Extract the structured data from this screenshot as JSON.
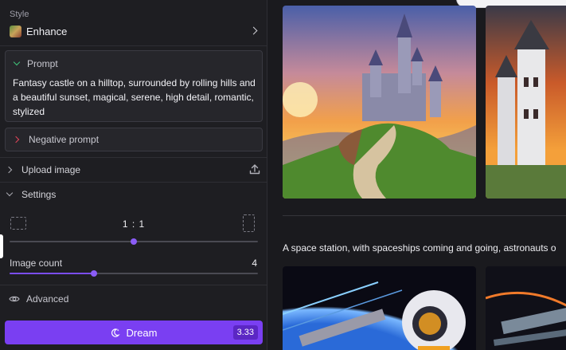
{
  "style": {
    "caption": "Style",
    "name": "Enhance"
  },
  "prompt": {
    "label": "Prompt",
    "text": "Fantasy castle on a hilltop, surrounded by rolling hills and a beautiful sunset, magical, serene, high detail, romantic, stylized"
  },
  "negative_prompt": {
    "label": "Negative prompt"
  },
  "upload": {
    "label": "Upload image"
  },
  "settings": {
    "label": "Settings",
    "aspect_ratio": "1 : 1",
    "aspect_ratio_position": 0.5,
    "image_count_label": "Image count",
    "image_count": "4",
    "image_count_position": 0.34
  },
  "advanced": {
    "label": "Advanced"
  },
  "dream_button": {
    "label": "Dream",
    "cost": "3.33"
  },
  "gallery": {
    "second_prompt": "A space station, with spaceships coming and going, astronauts o"
  },
  "colors": {
    "accent": "#7a3ff2",
    "prompt_chevron": "#3fc47a",
    "negative_chevron": "#e0455a"
  },
  "icons": {
    "style": "style-thumbnail-icon",
    "upload": "upload-icon",
    "eye": "eye-icon",
    "dream": "moon-sparkle-icon"
  }
}
